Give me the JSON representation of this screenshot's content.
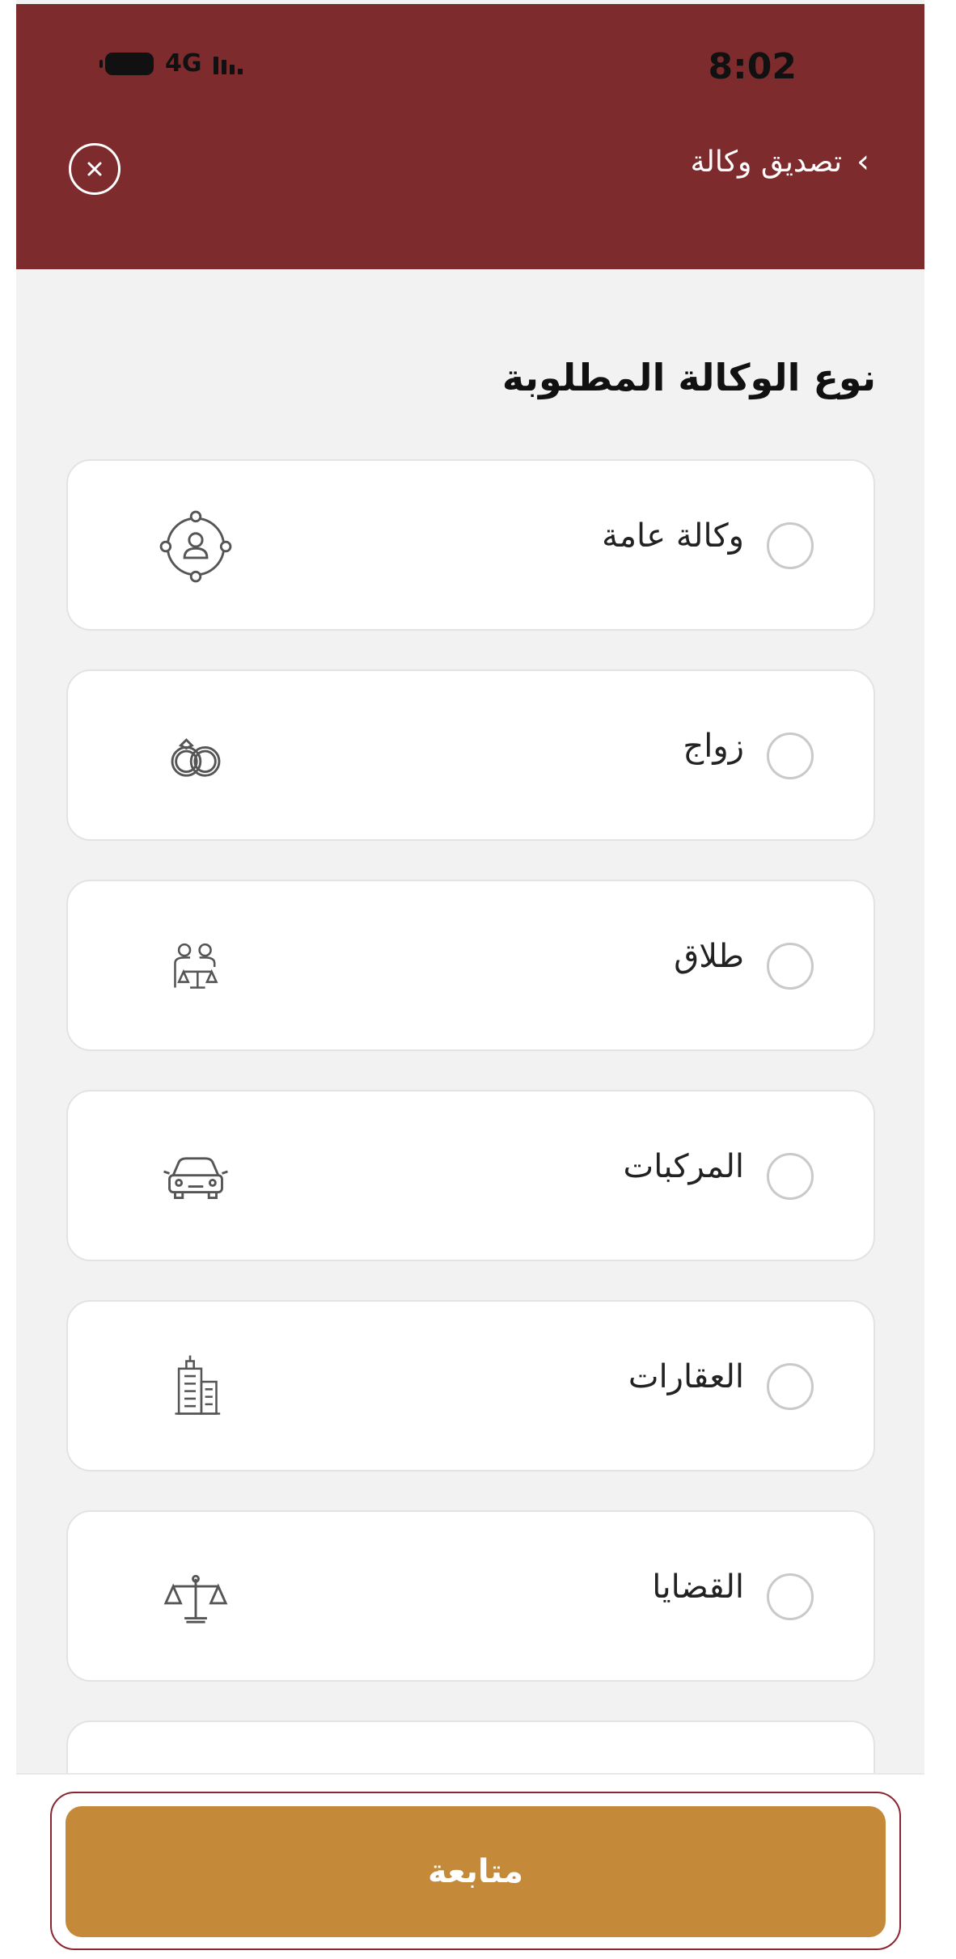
{
  "status_bar": {
    "time": "8:02",
    "network": "4G"
  },
  "header": {
    "title": "تصديق وكالة",
    "back_icon": "chevron-right-icon",
    "close_icon": "close-icon"
  },
  "section_title": "نوع الوكالة المطلوبة",
  "options": [
    {
      "label": "وكالة عامة",
      "icon": "person-network-icon",
      "selected": false
    },
    {
      "label": "زواج",
      "icon": "rings-icon",
      "selected": false
    },
    {
      "label": "طلاق",
      "icon": "couple-scales-icon",
      "selected": false
    },
    {
      "label": "المركبات",
      "icon": "car-icon",
      "selected": false
    },
    {
      "label": "العقارات",
      "icon": "building-icon",
      "selected": false
    },
    {
      "label": "القضايا",
      "icon": "scales-icon",
      "selected": false
    }
  ],
  "footer": {
    "continue_label": "متابعة"
  },
  "colors": {
    "header": "#7e2b2d",
    "button": "#c48939",
    "button_outline": "#8a2631",
    "background": "#f2f2f2"
  }
}
